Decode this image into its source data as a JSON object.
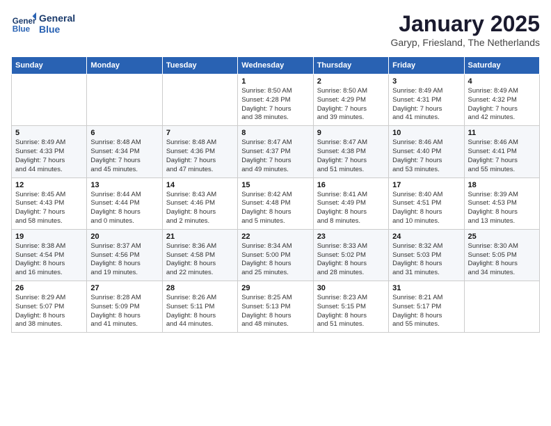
{
  "header": {
    "logo_line1": "General",
    "logo_line2": "Blue",
    "month": "January 2025",
    "location": "Garyp, Friesland, The Netherlands"
  },
  "weekdays": [
    "Sunday",
    "Monday",
    "Tuesday",
    "Wednesday",
    "Thursday",
    "Friday",
    "Saturday"
  ],
  "weeks": [
    [
      {
        "day": "",
        "info": ""
      },
      {
        "day": "",
        "info": ""
      },
      {
        "day": "",
        "info": ""
      },
      {
        "day": "1",
        "info": "Sunrise: 8:50 AM\nSunset: 4:28 PM\nDaylight: 7 hours\nand 38 minutes."
      },
      {
        "day": "2",
        "info": "Sunrise: 8:50 AM\nSunset: 4:29 PM\nDaylight: 7 hours\nand 39 minutes."
      },
      {
        "day": "3",
        "info": "Sunrise: 8:49 AM\nSunset: 4:31 PM\nDaylight: 7 hours\nand 41 minutes."
      },
      {
        "day": "4",
        "info": "Sunrise: 8:49 AM\nSunset: 4:32 PM\nDaylight: 7 hours\nand 42 minutes."
      }
    ],
    [
      {
        "day": "5",
        "info": "Sunrise: 8:49 AM\nSunset: 4:33 PM\nDaylight: 7 hours\nand 44 minutes."
      },
      {
        "day": "6",
        "info": "Sunrise: 8:48 AM\nSunset: 4:34 PM\nDaylight: 7 hours\nand 45 minutes."
      },
      {
        "day": "7",
        "info": "Sunrise: 8:48 AM\nSunset: 4:36 PM\nDaylight: 7 hours\nand 47 minutes."
      },
      {
        "day": "8",
        "info": "Sunrise: 8:47 AM\nSunset: 4:37 PM\nDaylight: 7 hours\nand 49 minutes."
      },
      {
        "day": "9",
        "info": "Sunrise: 8:47 AM\nSunset: 4:38 PM\nDaylight: 7 hours\nand 51 minutes."
      },
      {
        "day": "10",
        "info": "Sunrise: 8:46 AM\nSunset: 4:40 PM\nDaylight: 7 hours\nand 53 minutes."
      },
      {
        "day": "11",
        "info": "Sunrise: 8:46 AM\nSunset: 4:41 PM\nDaylight: 7 hours\nand 55 minutes."
      }
    ],
    [
      {
        "day": "12",
        "info": "Sunrise: 8:45 AM\nSunset: 4:43 PM\nDaylight: 7 hours\nand 58 minutes."
      },
      {
        "day": "13",
        "info": "Sunrise: 8:44 AM\nSunset: 4:44 PM\nDaylight: 8 hours\nand 0 minutes."
      },
      {
        "day": "14",
        "info": "Sunrise: 8:43 AM\nSunset: 4:46 PM\nDaylight: 8 hours\nand 2 minutes."
      },
      {
        "day": "15",
        "info": "Sunrise: 8:42 AM\nSunset: 4:48 PM\nDaylight: 8 hours\nand 5 minutes."
      },
      {
        "day": "16",
        "info": "Sunrise: 8:41 AM\nSunset: 4:49 PM\nDaylight: 8 hours\nand 8 minutes."
      },
      {
        "day": "17",
        "info": "Sunrise: 8:40 AM\nSunset: 4:51 PM\nDaylight: 8 hours\nand 10 minutes."
      },
      {
        "day": "18",
        "info": "Sunrise: 8:39 AM\nSunset: 4:53 PM\nDaylight: 8 hours\nand 13 minutes."
      }
    ],
    [
      {
        "day": "19",
        "info": "Sunrise: 8:38 AM\nSunset: 4:54 PM\nDaylight: 8 hours\nand 16 minutes."
      },
      {
        "day": "20",
        "info": "Sunrise: 8:37 AM\nSunset: 4:56 PM\nDaylight: 8 hours\nand 19 minutes."
      },
      {
        "day": "21",
        "info": "Sunrise: 8:36 AM\nSunset: 4:58 PM\nDaylight: 8 hours\nand 22 minutes."
      },
      {
        "day": "22",
        "info": "Sunrise: 8:34 AM\nSunset: 5:00 PM\nDaylight: 8 hours\nand 25 minutes."
      },
      {
        "day": "23",
        "info": "Sunrise: 8:33 AM\nSunset: 5:02 PM\nDaylight: 8 hours\nand 28 minutes."
      },
      {
        "day": "24",
        "info": "Sunrise: 8:32 AM\nSunset: 5:03 PM\nDaylight: 8 hours\nand 31 minutes."
      },
      {
        "day": "25",
        "info": "Sunrise: 8:30 AM\nSunset: 5:05 PM\nDaylight: 8 hours\nand 34 minutes."
      }
    ],
    [
      {
        "day": "26",
        "info": "Sunrise: 8:29 AM\nSunset: 5:07 PM\nDaylight: 8 hours\nand 38 minutes."
      },
      {
        "day": "27",
        "info": "Sunrise: 8:28 AM\nSunset: 5:09 PM\nDaylight: 8 hours\nand 41 minutes."
      },
      {
        "day": "28",
        "info": "Sunrise: 8:26 AM\nSunset: 5:11 PM\nDaylight: 8 hours\nand 44 minutes."
      },
      {
        "day": "29",
        "info": "Sunrise: 8:25 AM\nSunset: 5:13 PM\nDaylight: 8 hours\nand 48 minutes."
      },
      {
        "day": "30",
        "info": "Sunrise: 8:23 AM\nSunset: 5:15 PM\nDaylight: 8 hours\nand 51 minutes."
      },
      {
        "day": "31",
        "info": "Sunrise: 8:21 AM\nSunset: 5:17 PM\nDaylight: 8 hours\nand 55 minutes."
      },
      {
        "day": "",
        "info": ""
      }
    ]
  ]
}
